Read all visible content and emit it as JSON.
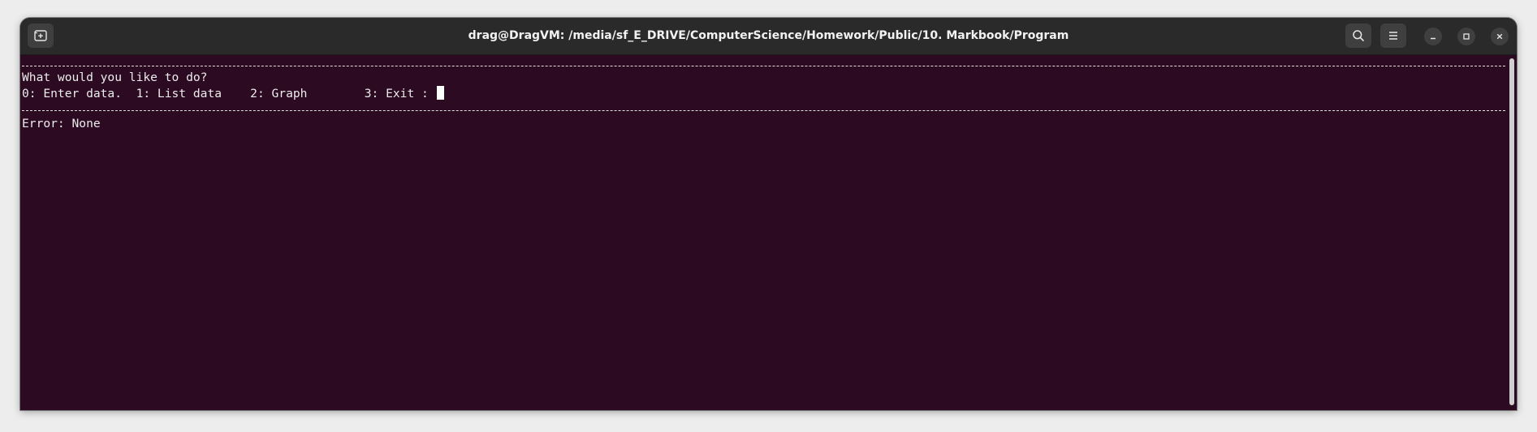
{
  "window": {
    "title": "drag@DragVM: /media/sf_E_DRIVE/ComputerScience/Homework/Public/10. Markbook/Program"
  },
  "titlebar": {
    "new_tab_icon": "new-tab-icon",
    "search_icon": "search-icon",
    "menu_icon": "hamburger-menu-icon",
    "minimize_icon": "minimize-icon",
    "maximize_icon": "maximize-icon",
    "close_icon": "close-icon"
  },
  "terminal": {
    "prompt_question": "What would you like to do?",
    "options_line": "0: Enter data.  1: List data    2: Graph        3: Exit : ",
    "error_line": "Error: None",
    "background_color": "#2c0b22",
    "text_color": "#ececec"
  }
}
